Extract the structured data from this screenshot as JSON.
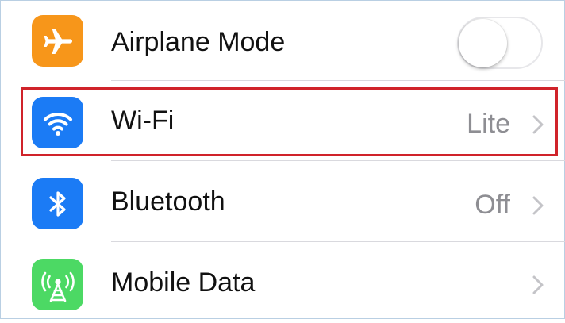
{
  "settings": {
    "rows": [
      {
        "label": "Airplane Mode",
        "icon": "airplane-icon",
        "color": "#f7961a",
        "toggle_on": false
      },
      {
        "label": "Wi-Fi",
        "icon": "wifi-icon",
        "color": "#1b7bf5",
        "value": "Lite"
      },
      {
        "label": "Bluetooth",
        "icon": "bluetooth-icon",
        "color": "#1b7bf5",
        "value": "Off"
      },
      {
        "label": "Mobile Data",
        "icon": "cellular-antenna-icon",
        "color": "#4cd964"
      }
    ]
  },
  "highlight": {
    "target": "Wi-Fi",
    "color": "#d0232a"
  }
}
